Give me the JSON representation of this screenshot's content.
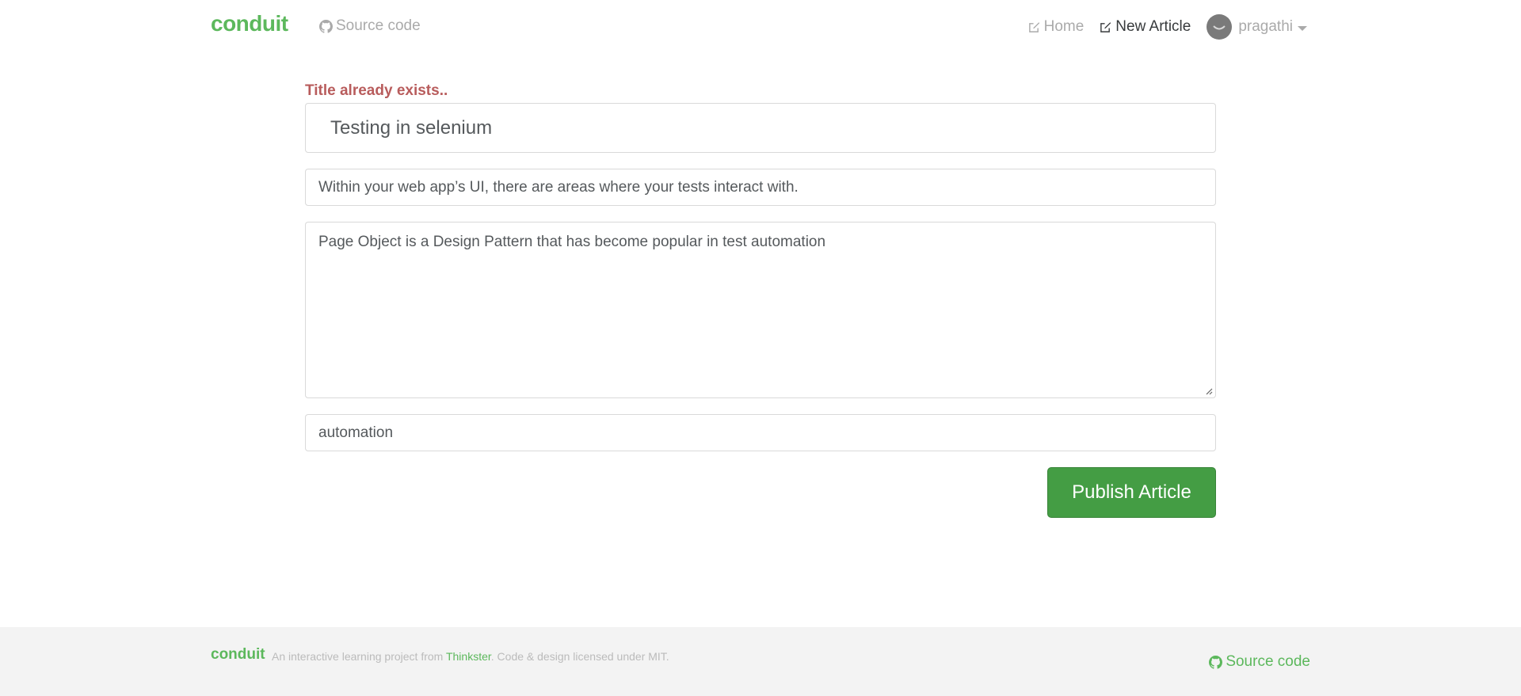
{
  "navbar": {
    "brand": "conduit",
    "source_code": "Source code",
    "home": "Home",
    "new_article": "New Article",
    "username": "pragathi"
  },
  "editor": {
    "error": "Title already exists..",
    "title_value": "Testing in selenium",
    "description_value": "Within your web app’s UI, there are areas where your tests interact with.",
    "body_value": "Page Object is a Design Pattern that has become popular in test automation",
    "tags_value": "automation",
    "publish_label": "Publish Article"
  },
  "footer": {
    "brand": "conduit",
    "text_before": "An interactive learning project from ",
    "link": "Thinkster",
    "text_after": ". Code & design licensed under MIT.",
    "source_code": "Source code"
  },
  "colors": {
    "brand": "#5cb85c",
    "error": "#b85c5c",
    "button": "#449d44",
    "footer_bg": "#f3f3f3"
  }
}
